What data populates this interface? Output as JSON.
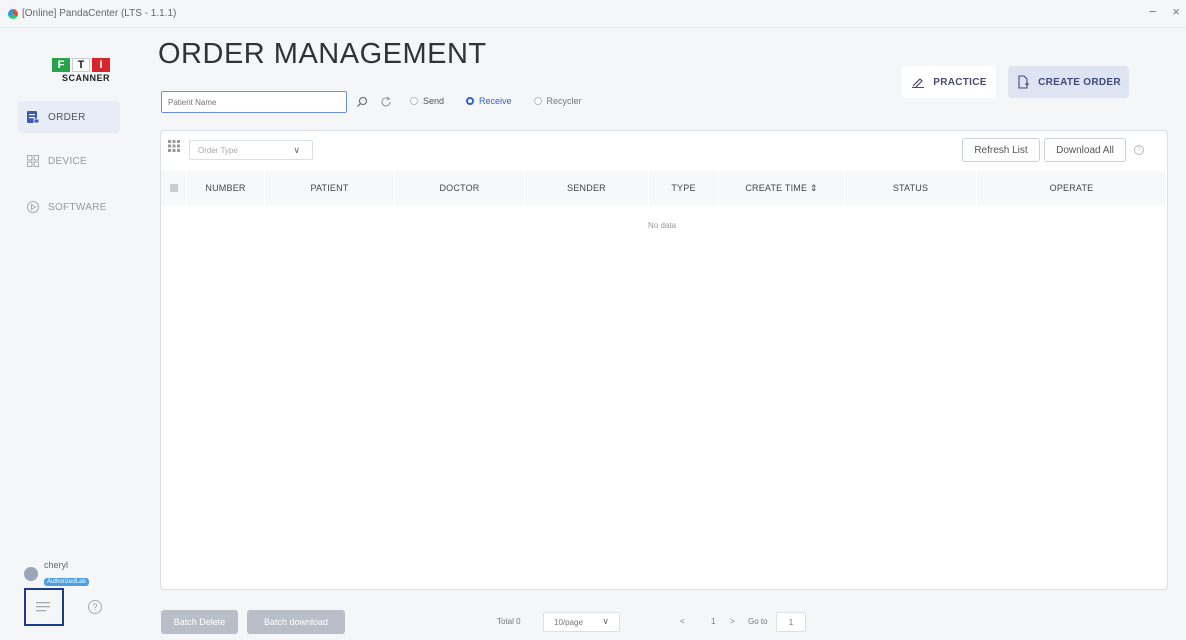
{
  "window": {
    "title": "[Online] PandaCenter (LTS - 1.1.1)",
    "minimize": "−",
    "close": "×"
  },
  "logo": {
    "l1": "F",
    "l2": "T",
    "l3": "I",
    "text": "SCANNER"
  },
  "sidebar": {
    "items": [
      {
        "label": "ORDER",
        "icon": "order-icon",
        "active": true
      },
      {
        "label": "DEVICE",
        "icon": "device-icon",
        "active": false
      },
      {
        "label": "SOFTWARE",
        "icon": "software-icon",
        "active": false
      }
    ]
  },
  "user": {
    "name": "cheryl",
    "badge": "AuthorizedLab"
  },
  "help": "?",
  "page": {
    "title": "ORDER MANAGEMENT"
  },
  "actions": {
    "practice": "PRACTICE",
    "create_order": "CREATE ORDER"
  },
  "search": {
    "placeholder": "Patient Name",
    "value": ""
  },
  "filters": {
    "options": [
      {
        "label": "Send",
        "checked": false
      },
      {
        "label": "Receive",
        "checked": true
      },
      {
        "label": "Recycler",
        "checked": false
      }
    ]
  },
  "toolbar": {
    "order_type_placeholder": "Order Type",
    "refresh_list": "Refresh List",
    "download_all": "Download All"
  },
  "table": {
    "columns": [
      "NUMBER",
      "PATIENT",
      "DOCTOR",
      "SENDER",
      "TYPE",
      "CREATE TIME ⇕",
      "STATUS",
      "OPERATE"
    ],
    "empty_text": "No data"
  },
  "footer": {
    "batch_delete": "Batch Delete",
    "batch_download": "Batch download",
    "total": "Total 0",
    "page_size": "10/page",
    "prev": "<",
    "page": "1",
    "next": ">",
    "goto_label": "Go to",
    "goto_value": "1"
  },
  "colors": {
    "accent": "#2f5fd0",
    "sidebar_active": "#e8ecf7",
    "batch_btn": "#b9bec8"
  }
}
